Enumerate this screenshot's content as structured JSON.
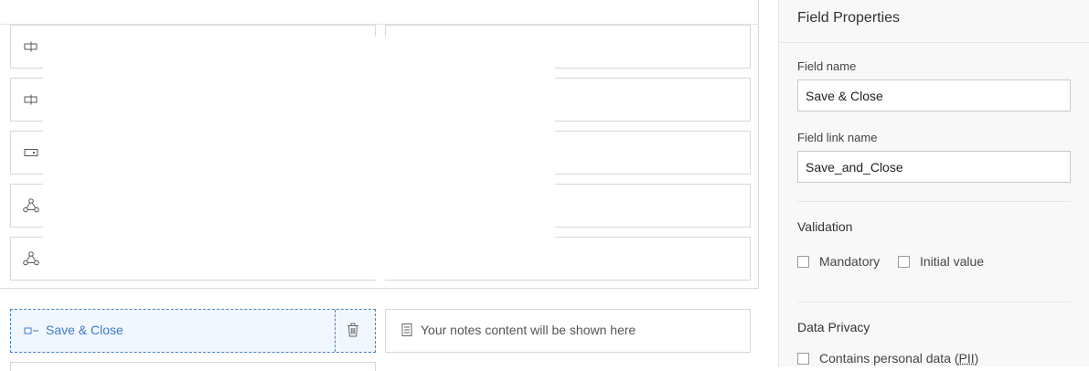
{
  "canvas": {
    "rows": [
      {
        "icon": "button-icon"
      },
      {
        "icon": "button-icon"
      },
      {
        "icon": "input-box-icon"
      },
      {
        "icon": "workflow-icon"
      },
      {
        "icon": "workflow-icon"
      }
    ],
    "selected_field": {
      "label": "Save & Close",
      "icon": "button-icon",
      "delete_icon": "trash-icon"
    },
    "notes": {
      "text": "Your notes content will be shown here",
      "icon": "document-icon"
    }
  },
  "panel": {
    "title": "Field Properties",
    "field_name_label": "Field name",
    "field_name_value": "Save & Close",
    "field_link_label": "Field link name",
    "field_link_value": "Save_and_Close",
    "validation": {
      "heading": "Validation",
      "mandatory_label": "Mandatory",
      "initial_value_label": "Initial value"
    },
    "privacy": {
      "heading": "Data Privacy",
      "pii_label_prefix": "Contains personal data (",
      "pii_abbr": "PII",
      "pii_label_suffix": ")"
    }
  },
  "colors": {
    "accent": "#3b7bc8",
    "selected_bg": "#f1f7fe",
    "panel_bg": "#f8f8f8"
  }
}
